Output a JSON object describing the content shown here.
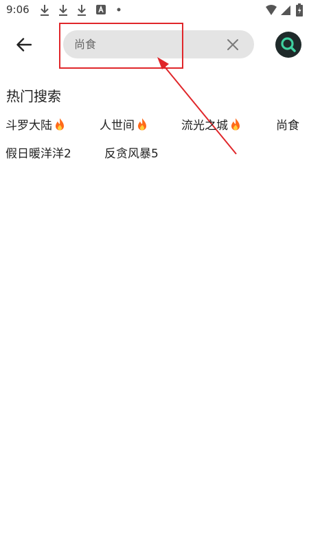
{
  "status_bar": {
    "time": "9:06",
    "icons": [
      "download-icon",
      "download-icon",
      "download-icon",
      "app-a-icon",
      "dot-icon",
      "wifi-icon",
      "signal-icon",
      "battery-charging-icon"
    ]
  },
  "search": {
    "value": "尚食",
    "placeholder": "",
    "clear_icon": "close-icon",
    "submit_icon": "search-icon",
    "submit_bg": "#1f2a2a",
    "submit_accent": "#3fd1a0"
  },
  "hot": {
    "title": "热门搜索",
    "tags": [
      {
        "label": "斗罗大陆",
        "hot": true
      },
      {
        "label": "人世间",
        "hot": true
      },
      {
        "label": "流光之城",
        "hot": true
      },
      {
        "label": "尚食",
        "hot": false
      },
      {
        "label": "假日暖洋洋2",
        "hot": false
      },
      {
        "label": "反贪风暴5",
        "hot": false
      }
    ]
  },
  "annotation": {
    "color": "#e0262a"
  }
}
